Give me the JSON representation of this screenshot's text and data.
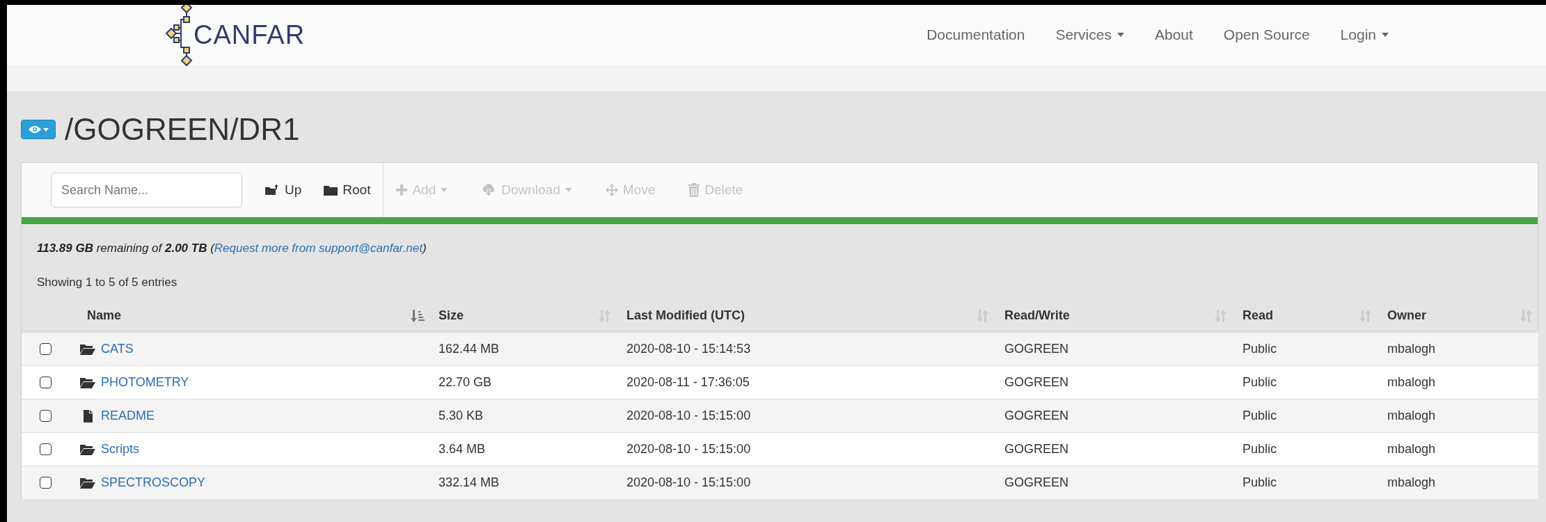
{
  "navbar": {
    "logo_text": "CANFAR",
    "items": [
      {
        "label": "Documentation",
        "dropdown": false
      },
      {
        "label": "Services",
        "dropdown": true
      },
      {
        "label": "About",
        "dropdown": false
      },
      {
        "label": "Open Source",
        "dropdown": false
      },
      {
        "label": "Login",
        "dropdown": true
      }
    ]
  },
  "page_title": "/GOGREEN/DR1",
  "toolbar": {
    "search": {
      "placeholder": "Search Name..."
    },
    "buttons": [
      {
        "kind": "up",
        "label": "Up",
        "disabled": false,
        "dropdown": false
      },
      {
        "kind": "root",
        "label": "Root",
        "disabled": false,
        "dropdown": false
      },
      {
        "kind": "add",
        "label": "Add",
        "disabled": true,
        "dropdown": true
      },
      {
        "kind": "download",
        "label": "Download",
        "disabled": true,
        "dropdown": true
      },
      {
        "kind": "move",
        "label": "Move",
        "disabled": true,
        "dropdown": false
      },
      {
        "kind": "delete",
        "label": "Delete",
        "disabled": true,
        "dropdown": false
      }
    ]
  },
  "progress": {
    "level": 1
  },
  "quota": {
    "text": "**113.89 GB** remaining of **2.00 TB** (",
    "link": "Request more from support@canfar.net",
    "after": ")"
  },
  "showing": "Showing 1 to 5 of 5 entries",
  "table": {
    "columns": [
      {
        "label": "Name",
        "sorted": true
      },
      {
        "label": "Size",
        "sorted": false
      },
      {
        "label": "Last Modified (UTC)",
        "sorted": false
      },
      {
        "label": "Read/Write",
        "sorted": false
      },
      {
        "label": "Read",
        "sorted": false
      },
      {
        "label": "Owner",
        "sorted": false
      }
    ],
    "rows": [
      {
        "checked": false,
        "kind": "folder",
        "name": "CATS",
        "size": "162.44 MB",
        "modified": "2020-08-10 - 15:14:53",
        "read_write": "GOGREEN",
        "read": "Public",
        "owner": "mbalogh"
      },
      {
        "checked": false,
        "kind": "folder",
        "name": "PHOTOMETRY",
        "size": "22.70 GB",
        "modified": "2020-08-11 - 17:36:05",
        "read_write": "GOGREEN",
        "read": "Public",
        "owner": "mbalogh"
      },
      {
        "checked": false,
        "kind": "file",
        "name": "README",
        "size": "5.30 KB",
        "modified": "2020-08-10 - 15:15:00",
        "read_write": "GOGREEN",
        "read": "Public",
        "owner": "mbalogh"
      },
      {
        "checked": false,
        "kind": "folder",
        "name": "Scripts",
        "size": "3.64 MB",
        "modified": "2020-08-10 - 15:15:00",
        "read_write": "GOGREEN",
        "read": "Public",
        "owner": "mbalogh"
      },
      {
        "checked": false,
        "kind": "folder",
        "name": "SPECTROSCOPY",
        "size": "332.14 MB",
        "modified": "2020-08-10 - 15:15:00",
        "read_write": "GOGREEN",
        "read": "Public",
        "owner": "mbalogh"
      }
    ]
  }
}
